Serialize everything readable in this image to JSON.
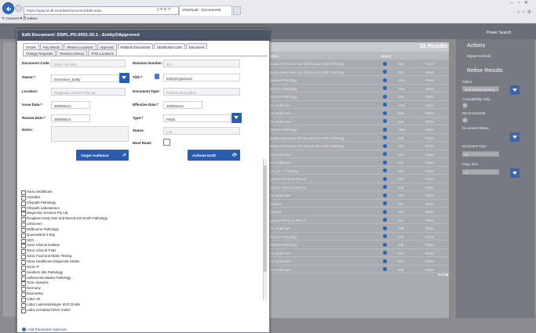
{
  "browser": {
    "url": "https://sgsynd.dll.smartlab/Document/Edit.aspx",
    "tab_title": "SmartLab - Documents",
    "command_bar": "✎ Convert ▾  🗎 Select"
  },
  "app": {
    "power_search": "Power Search"
  },
  "results": {
    "count": "51 Results",
    "col_description": "...ription",
    "col_status": "Status",
    "next": "Next ▶",
    "rows": [
      {
        "text": "Alabama Henry Mart and Barrett and Smith Pathology",
        "edit": "Edit",
        "retire": "Retire"
      },
      {
        "text": "Alabama Henry Mart and Barrett and Smith Pathology",
        "edit": "Edit",
        "retire": "Retire"
      },
      {
        "text": "Melbourne Pathology",
        "edit": "View",
        "retire": "Retire"
      },
      {
        "text": "Melbourne Pathology",
        "edit": "View",
        "retire": "Retire"
      },
      {
        "text": "Melbourne Pathology",
        "edit": "Edit",
        "retire": "Retire"
      },
      {
        "text": "Sonic Healthcare",
        "edit": "View",
        "retire": "Retire"
      },
      {
        "text": "Sonic Healthcare",
        "edit": "Edit",
        "retire": "Retire"
      },
      {
        "text": "Sonic Healthcare",
        "edit": "Edit",
        "retire": "Retire"
      },
      {
        "text": "Melbourne Pathology",
        "edit": "View",
        "retire": "Retire"
      },
      {
        "text": "Alabama Henry Mart and Barrett and Smith Pathology",
        "edit": "Edit",
        "retire": "Retire"
      },
      {
        "text": "Alabama Henry Mart and Barrett and Smith Pathology",
        "edit": "Edit",
        "retire": "Retire"
      },
      {
        "text": "Sonic Healthcare",
        "edit": "Edit",
        "retire": "Retire"
      },
      {
        "text": "Sonic Healthcare",
        "edit": "Edit",
        "retire": "Retire"
      },
      {
        "text": "Sonic Lab - Chemistry",
        "edit": "Edit",
        "retire": "Retire"
      },
      {
        "text": "Diagnostic Services Pty Ltd",
        "edit": "Edit",
        "retire": "Retire"
      },
      {
        "text": "Diagnostic Services Pty Ltd",
        "edit": "Edit",
        "retire": "Retire"
      },
      {
        "text": "Sonic Healthcare",
        "edit": "Edit",
        "retire": "Retire"
      },
      {
        "text": "Laboratory",
        "edit": "Edit",
        "retire": "Retire"
      },
      {
        "text": "Laboratory",
        "edit": "Edit",
        "retire": "Retire"
      },
      {
        "text": "Diagnostic Services Pty Ltd",
        "edit": "Edit",
        "retire": "Retire"
      },
      {
        "text": "Sonic Healthcare",
        "edit": "Edit",
        "retire": "Retire"
      },
      {
        "text": "Melbourne Pathology",
        "edit": "Edit",
        "retire": "Retire"
      },
      {
        "text": "Melbourne Pathology",
        "edit": "Edit",
        "retire": "Retire"
      },
      {
        "text": "Sonic Healthcare",
        "edit": "Edit",
        "retire": "Retire"
      },
      {
        "text": "Sonic Healthcare",
        "edit": "Edit",
        "retire": "Retire"
      },
      {
        "text": "Sonic Healthcare",
        "edit": "Edit",
        "retire": "Retire"
      }
    ]
  },
  "right_panel": {
    "actions_title": "Actions",
    "export": "Export to Excel",
    "refine_title": "Refine Results",
    "filter_label": "Filters",
    "filter_value": "All & Default Ranking",
    "comp_label": "Compatibility Only",
    "my_docs_label": "My Documents",
    "doc_status_label": "Document Status",
    "doc_type_label": "Document Type",
    "doc_type_value": "All",
    "page_size_label": "Page Size",
    "page_size_value": "20"
  },
  "dialog": {
    "title": "Edit Document: DSPL.PD.0001.00.1 - EntityOApproved",
    "tabs_row1": [
      "Details",
      "Key Words",
      "Shared Locations",
      "Approval",
      "Related Documents",
      "Distribution Lists",
      "Document"
    ],
    "tabs_row2": [
      "Change Requests",
      "Revision History",
      "Print Locations"
    ],
    "doc_code_label": "Document Code:",
    "doc_code_value": "DSPL.PD.0001",
    "rev_num_label": "Revision Number:",
    "rev_num_value": "00.1",
    "owner_label": "Owner:*",
    "owner_value": "DocOwner_Entity",
    "title_label": "Title:*",
    "title_value": "EntityOApproved",
    "location_label": "Location:",
    "location_value": "Diagnostic Services Pty Ltd",
    "doc_type_label": "Document Type:",
    "doc_type_value": "Position Description",
    "issue_label": "Issue Date:*",
    "issue_value": "26/08/2013",
    "effective_label": "Effective Date:*",
    "effective_value": "26/08/2013",
    "review_label": "Review Date:*",
    "review_value": "26/08/2014",
    "type_label": "Type:*",
    "type_value": "Public",
    "notes_label": "Notes:",
    "status_label": "Status:",
    "status_value": "Live",
    "mostread_label": "Most Read:",
    "target_btn": "Target Audience",
    "activate_btn": "Activate Draft",
    "add_approver": "Add Document Approver",
    "list": [
      "Sonic Healthcare",
      "Australia",
      "Clinipath Pathology",
      "Clinipath Laboratories",
      "Diagnostic Services Pty Ltd",
      "Douglass Hanly Moir and Barrett and Smith Pathology",
      "Lifescreen",
      "Melbourne Pathology",
      "Queensland X-Ray",
      "SKG",
      "Sonic Clinical Institute",
      "Sonic Clinical Trials",
      "Sonic Food and Water Testing",
      "Sonic Healthcare Diagnostic Media",
      "Sonic IT",
      "Southern IML Pathology",
      "Sullivan Nicolaides Pathology",
      "Tonic Systems",
      "Germany",
      "Bioscientia",
      "Labor 28",
      "Labor Lademannbogen MVZ GmbH",
      "Labor Schottdorf MVZ GmbH"
    ]
  }
}
